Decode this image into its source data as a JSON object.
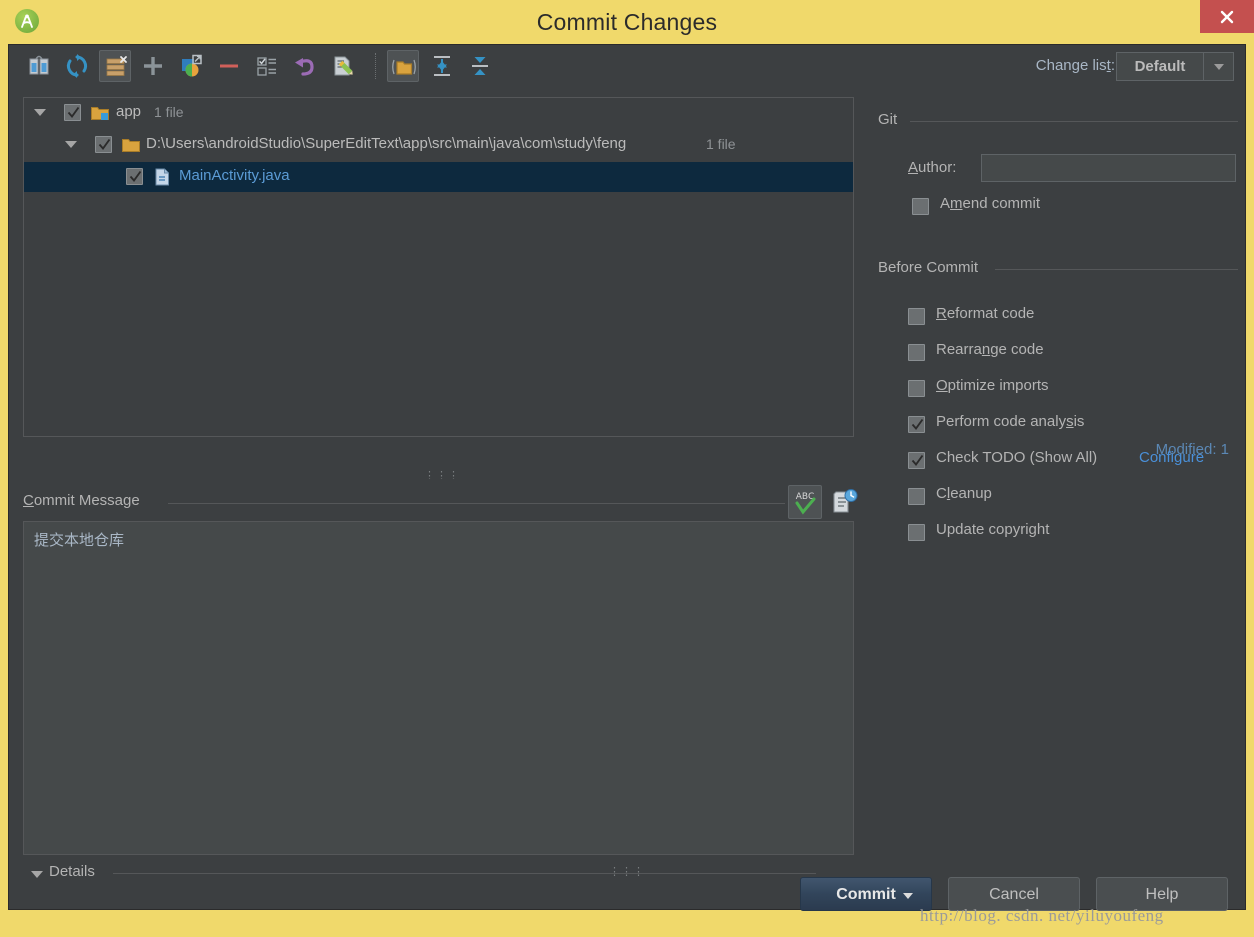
{
  "window": {
    "title": "Commit Changes",
    "app_icon": "android-studio-icon",
    "close_label": "×",
    "title_bar_color": "#f0d96b",
    "close_button_color": "#c4504f"
  },
  "toolbar": {
    "buttons": [
      {
        "name": "show-diff-icon",
        "title": "Show Diff"
      },
      {
        "name": "refresh-icon",
        "title": "Refresh Changes"
      },
      {
        "name": "delete-changelist-icon",
        "title": "Delete Changelist",
        "active": true
      },
      {
        "name": "add-changelist-icon",
        "title": "New Changelist"
      },
      {
        "name": "move-to-changelist-icon",
        "title": "Move to Another Changelist"
      },
      {
        "name": "remove-icon",
        "title": "Remove"
      },
      {
        "name": "set-active-changelist-icon",
        "title": "Set Active Changelist"
      },
      {
        "name": "rollback-icon",
        "title": "Rollback"
      },
      {
        "name": "edit-source-icon",
        "title": "Edit Source"
      },
      {
        "name": "group-by-directory-icon",
        "title": "Group by Directory",
        "active": true
      },
      {
        "name": "expand-all-icon",
        "title": "Expand All"
      },
      {
        "name": "collapse-all-icon",
        "title": "Collapse All"
      }
    ],
    "changelist_label": "Change list:",
    "changelist_label_prefix": "Change lis",
    "changelist_label_accel": "t",
    "changelist_label_suffix": ":",
    "changelist_value": "Default",
    "changelist_options": [
      "Default"
    ]
  },
  "tree": {
    "rows": [
      {
        "name": "tree-row-module",
        "label": "app",
        "count": "1 file",
        "icon": "module-folder-icon",
        "checked": true,
        "expanded": true,
        "selected": false
      },
      {
        "name": "tree-row-directory",
        "label": "D:\\Users\\androidStudio\\SuperEditText\\app\\src\\main\\java\\com\\study\\feng",
        "count": "1 file",
        "icon": "folder-icon",
        "checked": true,
        "expanded": true,
        "selected": false
      },
      {
        "name": "tree-row-file",
        "label": "MainActivity.java",
        "count": "",
        "icon": "java-file-icon",
        "checked": true,
        "expanded": null,
        "selected": true
      }
    ],
    "status": "Modified: 1",
    "status_color": "#5b88b5",
    "selection_color": "#0d293e",
    "file_text_color": "#5b9bd5"
  },
  "commit_message": {
    "title": "Commit Message",
    "title_accel": "C",
    "title_rest": "ommit Message",
    "text": "提交本地仓库",
    "spellcheck_icon": "abc-spellcheck-icon",
    "history_icon": "message-history-icon"
  },
  "details": {
    "label": "Details",
    "expanded": true
  },
  "splitter": {
    "handle": "⋮⋮⋮⋮⋮"
  },
  "right_panel": {
    "git_group": {
      "title": "Git",
      "author_label": "Author:",
      "author_accel": "A",
      "author_rest": "uthor:",
      "author_value": "",
      "amend_label": "Amend commit",
      "amend_prefix": "A",
      "amend_accel": "m",
      "amend_suffix": "end commit",
      "amend_checked": false
    },
    "before_commit_group": {
      "title": "Before Commit",
      "options": [
        {
          "name": "reformat-code-checkbox",
          "prefix": "",
          "accel": "R",
          "suffix": "eformat code",
          "checked": false
        },
        {
          "name": "rearrange-code-checkbox",
          "prefix": "Rearra",
          "accel": "n",
          "suffix": "ge code",
          "checked": false
        },
        {
          "name": "optimize-imports-checkbox",
          "prefix": "",
          "accel": "O",
          "suffix": "ptimize imports",
          "checked": false
        },
        {
          "name": "perform-code-analysis-checkbox",
          "prefix": "Perform code analy",
          "accel": "s",
          "suffix": "is",
          "checked": true
        },
        {
          "name": "check-todo-checkbox",
          "prefix": "Check TODO (Show All)",
          "accel": "",
          "suffix": "",
          "checked": true,
          "link": "Configure"
        },
        {
          "name": "cleanup-checkbox",
          "prefix": "C",
          "accel": "l",
          "suffix": "eanup",
          "checked": false
        },
        {
          "name": "update-copyright-checkbox",
          "prefix": "Update copyright",
          "accel": "",
          "suffix": "",
          "checked": false
        }
      ],
      "link_color": "#4a90d9"
    }
  },
  "buttons": {
    "commit": "Commit",
    "cancel": "Cancel",
    "help": "Help",
    "commit_accent": "#32455b"
  },
  "watermark": "http://blog. csdn. net/yiluyoufeng"
}
